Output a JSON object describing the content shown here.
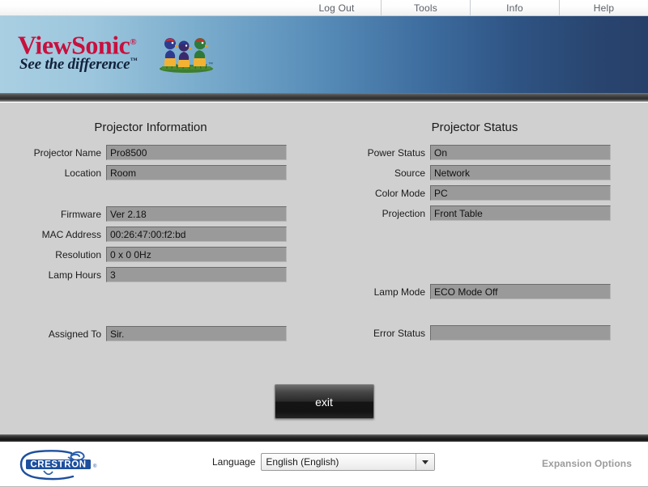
{
  "topnav": {
    "items": [
      {
        "label": "Log Out",
        "name": "log-out"
      },
      {
        "label": "Tools",
        "name": "tools"
      },
      {
        "label": "Info",
        "name": "info"
      },
      {
        "label": "Help",
        "name": "help"
      }
    ]
  },
  "banner": {
    "brand": "ViewSonic",
    "brand_tm": "®",
    "tagline": "See the difference",
    "tagline_tm": "™",
    "colors": {
      "brand_red": "#c8103e",
      "gradient_left": "#a9cfe2",
      "gradient_right": "#27406a"
    }
  },
  "main": {
    "left": {
      "title": "Projector Information",
      "fields": [
        {
          "label": "Projector Name",
          "value": "Pro8500"
        },
        {
          "label": "Location",
          "value": "Room"
        },
        {
          "label": "Firmware",
          "value": "Ver 2.18"
        },
        {
          "label": "MAC Address",
          "value": "00:26:47:00:f2:bd"
        },
        {
          "label": "Resolution",
          "value": "0 x 0 0Hz"
        },
        {
          "label": "Lamp Hours",
          "value": "3"
        },
        {
          "label": "Assigned To",
          "value": "Sir."
        }
      ]
    },
    "right": {
      "title": "Projector Status",
      "fields": [
        {
          "label": "Power Status",
          "value": "On"
        },
        {
          "label": "Source",
          "value": "Network"
        },
        {
          "label": "Color Mode",
          "value": "PC"
        },
        {
          "label": "Projection",
          "value": "Front Table"
        },
        {
          "label": "Lamp Mode",
          "value": "ECO Mode Off"
        },
        {
          "label": "Error Status",
          "value": ""
        }
      ]
    },
    "exit_label": "exit"
  },
  "footer": {
    "brand": "CRESTRON",
    "language_label": "Language",
    "language_value": "English (English)",
    "expansion_label": "Expansion Options"
  }
}
